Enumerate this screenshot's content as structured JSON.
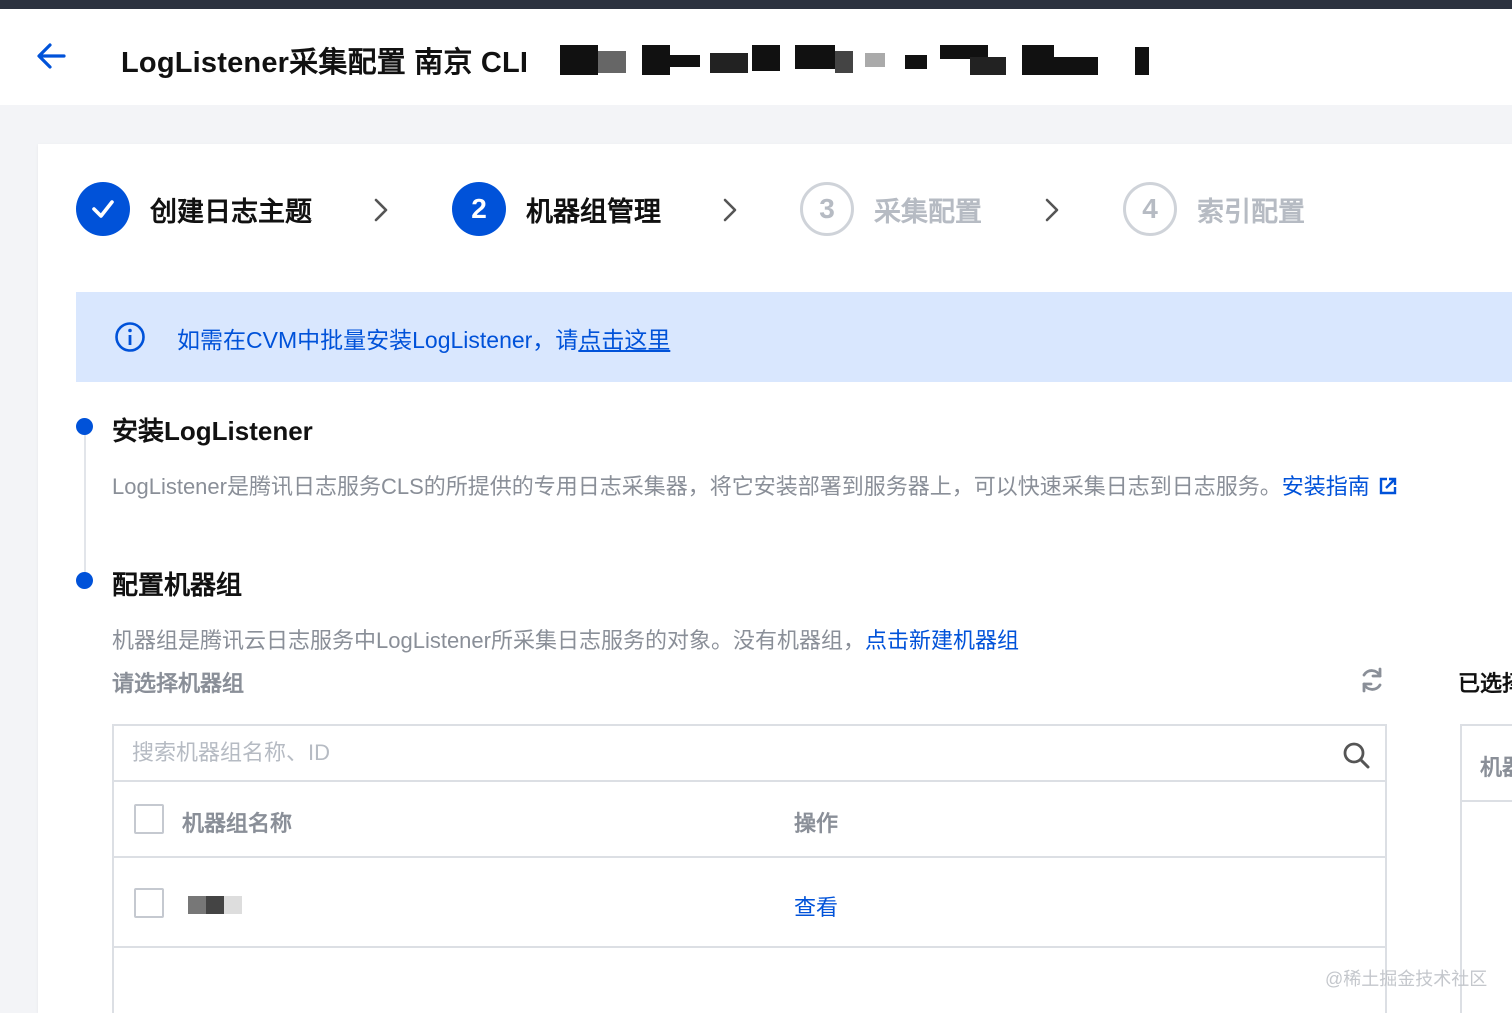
{
  "header": {
    "title": "LogListener采集配置 南京 CLI"
  },
  "steps": [
    {
      "number": "",
      "label": "创建日志主题",
      "state": "done",
      "icon": "check-icon"
    },
    {
      "number": "2",
      "label": "机器组管理",
      "state": "active"
    },
    {
      "number": "3",
      "label": "采集配置",
      "state": "todo"
    },
    {
      "number": "4",
      "label": "索引配置",
      "state": "todo"
    }
  ],
  "notice": {
    "icon": "info-icon",
    "text": "如需在CVM中批量安装LogListener，请",
    "link": "点击这里"
  },
  "install_section": {
    "title": "安装LogListener",
    "description": "LogListener是腾讯日志服务CLS的所提供的专用日志采集器，将它安装部署到服务器上，可以快速采集日志到日志服务。",
    "link": "安装指南"
  },
  "config_section": {
    "title": "配置机器组",
    "description": "机器组是腾讯云日志服务中LogListener所采集日志服务的对象。没有机器组，",
    "link": "点击新建机器组"
  },
  "machine_group": {
    "select_label": "请选择机器组",
    "selected_label": "已选择",
    "search_placeholder": "搜索机器组名称、ID",
    "columns": [
      "机器组名称",
      "操作"
    ],
    "rows": [
      {
        "name": "",
        "action": "查看"
      }
    ],
    "right_panel_header": "机器组"
  },
  "watermark": "@稀土掘金技术社区",
  "colors": {
    "primary": "#0052d9",
    "notice_bg": "#d9e7fe",
    "muted_text": "#8a8f98",
    "disabled": "#b6bbc3"
  }
}
